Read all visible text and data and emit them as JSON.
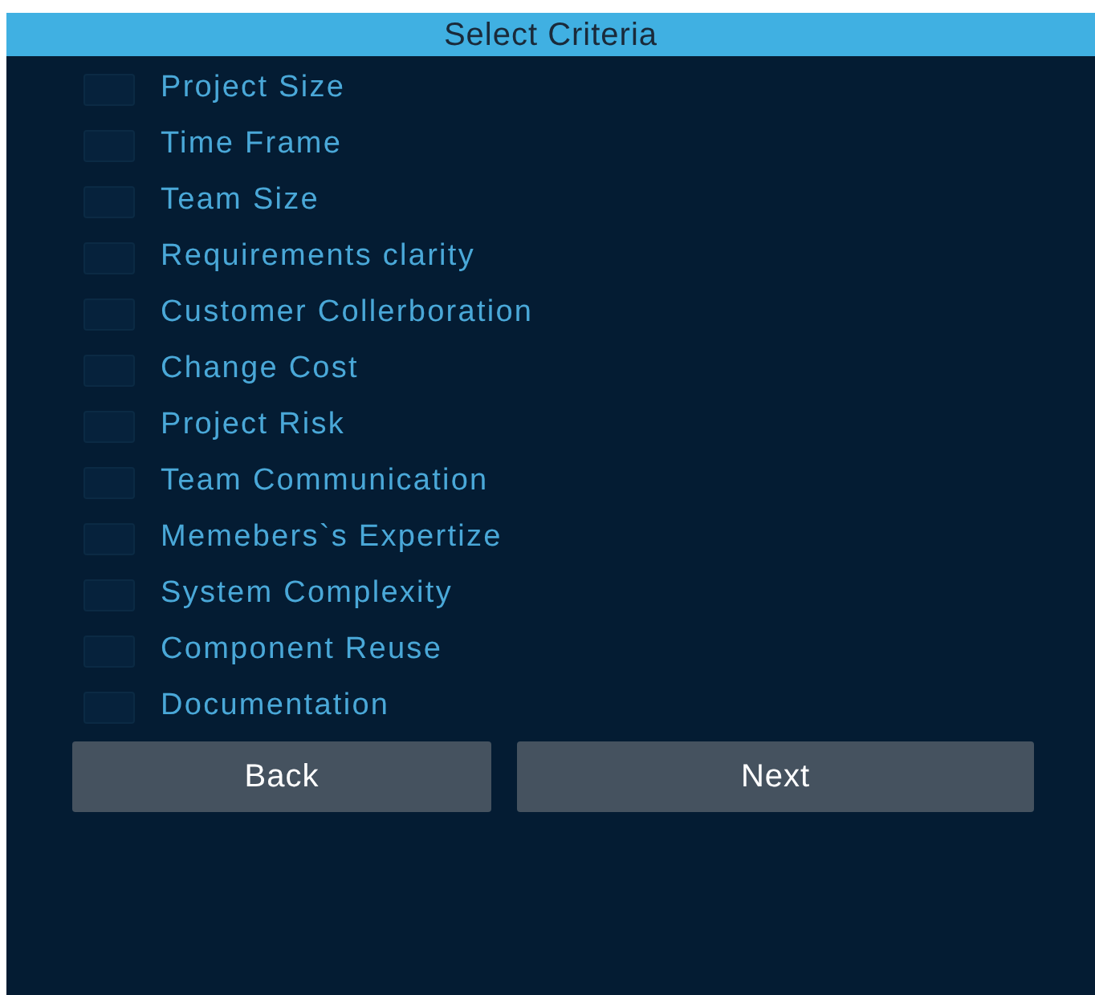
{
  "header": {
    "title": "Select Criteria"
  },
  "criteria": [
    {
      "label": "Project Size",
      "checked": false
    },
    {
      "label": "Time Frame",
      "checked": false
    },
    {
      "label": "Team Size",
      "checked": false
    },
    {
      "label": "Requirements clarity",
      "checked": false
    },
    {
      "label": "Customer Collerboration",
      "checked": false
    },
    {
      "label": "Change Cost",
      "checked": false
    },
    {
      "label": "Project Risk",
      "checked": false
    },
    {
      "label": "Team Communication",
      "checked": false
    },
    {
      "label": "Memebers`s Expertize",
      "checked": false
    },
    {
      "label": "System Complexity",
      "checked": false
    },
    {
      "label": "Component Reuse",
      "checked": false
    },
    {
      "label": "Documentation",
      "checked": false
    }
  ],
  "buttons": [
    {
      "label": "Back"
    },
    {
      "label": "Next"
    }
  ]
}
